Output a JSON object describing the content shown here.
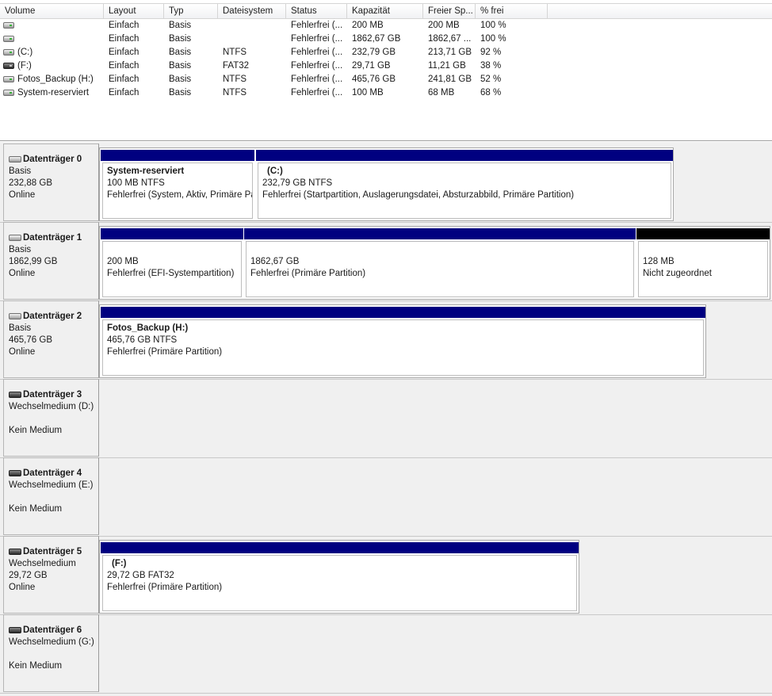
{
  "volume_list": {
    "headers": [
      "Volume",
      "Layout",
      "Typ",
      "Dateisystem",
      "Status",
      "Kapazität",
      "Freier Sp...",
      "% frei"
    ],
    "rows": [
      {
        "volume": "",
        "layout": "Einfach",
        "typ": "Basis",
        "fs": "",
        "status": "Fehlerfrei (...",
        "kapazitaet": "200 MB",
        "frei": "200 MB",
        "prozent": "100 %",
        "icon": "hdd-icon"
      },
      {
        "volume": "",
        "layout": "Einfach",
        "typ": "Basis",
        "fs": "",
        "status": "Fehlerfrei (...",
        "kapazitaet": "1862,67 GB",
        "frei": "1862,67 ...",
        "prozent": "100 %",
        "icon": "hdd-icon"
      },
      {
        "volume": "(C:)",
        "layout": "Einfach",
        "typ": "Basis",
        "fs": "NTFS",
        "status": "Fehlerfrei (...",
        "kapazitaet": "232,79 GB",
        "frei": "213,71 GB",
        "prozent": "92 %",
        "icon": "hdd-icon"
      },
      {
        "volume": "(F:)",
        "layout": "Einfach",
        "typ": "Basis",
        "fs": "FAT32",
        "status": "Fehlerfrei (...",
        "kapazitaet": "29,71 GB",
        "frei": "11,21 GB",
        "prozent": "38 %",
        "icon": "removable-drive-icon"
      },
      {
        "volume": "Fotos_Backup (H:)",
        "layout": "Einfach",
        "typ": "Basis",
        "fs": "NTFS",
        "status": "Fehlerfrei (...",
        "kapazitaet": "465,76 GB",
        "frei": "241,81 GB",
        "prozent": "52 %",
        "icon": "hdd-icon"
      },
      {
        "volume": "System-reserviert",
        "layout": "Einfach",
        "typ": "Basis",
        "fs": "NTFS",
        "status": "Fehlerfrei (...",
        "kapazitaet": "100 MB",
        "frei": "68 MB",
        "prozent": "68 %",
        "icon": "hdd-icon"
      }
    ]
  },
  "disks": [
    {
      "title": "Datenträger 0",
      "type": "Basis",
      "size": "232,88 GB",
      "state": "Online",
      "icon": "hdd-icon",
      "partitions": [
        {
          "name": "System-reserviert",
          "size_fs": "100 MB NTFS",
          "status": "Fehlerfrei (System, Aktiv, Primäre Partition)",
          "bar": "primary"
        },
        {
          "name": "(C:)",
          "size_fs": "232,79 GB NTFS",
          "status": "Fehlerfrei (Startpartition, Auslagerungsdatei, Absturzabbild, Primäre Partition)",
          "bar": "primary"
        }
      ]
    },
    {
      "title": "Datenträger 1",
      "type": "Basis",
      "size": "1862,99 GB",
      "state": "Online",
      "icon": "hdd-icon",
      "partitions": [
        {
          "name": "",
          "size_fs": "200 MB",
          "status": "Fehlerfrei (EFI-Systempartition)",
          "bar": "primary"
        },
        {
          "name": "",
          "size_fs": "1862,67 GB",
          "status": "Fehlerfrei (Primäre Partition)",
          "bar": "primary"
        },
        {
          "name": "",
          "size_fs": "128 MB",
          "status": "Nicht zugeordnet",
          "bar": "unallocated"
        }
      ]
    },
    {
      "title": "Datenträger 2",
      "type": "Basis",
      "size": "465,76 GB",
      "state": "Online",
      "icon": "hdd-icon",
      "partitions": [
        {
          "name": "Fotos_Backup  (H:)",
          "size_fs": "465,76 GB NTFS",
          "status": "Fehlerfrei (Primäre Partition)",
          "bar": "primary"
        }
      ]
    },
    {
      "title": "Datenträger 3",
      "type": "Wechselmedium (D:)",
      "media": "Kein Medium",
      "icon": "removable-drive-icon"
    },
    {
      "title": "Datenträger 4",
      "type": "Wechselmedium (E:)",
      "media": "Kein Medium",
      "icon": "removable-drive-icon"
    },
    {
      "title": "Datenträger 5",
      "type": "Wechselmedium",
      "size": "29,72 GB",
      "state": "Online",
      "icon": "removable-drive-icon",
      "partitions": [
        {
          "name": "(F:)",
          "size_fs": "29,72 GB FAT32",
          "status": "Fehlerfrei (Primäre Partition)",
          "bar": "primary"
        }
      ]
    },
    {
      "title": "Datenträger 6",
      "type": "Wechselmedium (G:)",
      "media": "Kein Medium",
      "icon": "removable-drive-icon"
    }
  ],
  "colors": {
    "primary_partition": "#000080",
    "unallocated": "#000000",
    "panel": "#f0f0f0"
  }
}
